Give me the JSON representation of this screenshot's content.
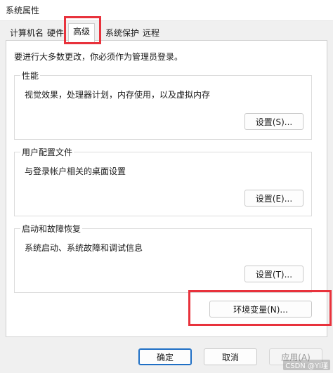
{
  "window": {
    "title": "系统属性"
  },
  "tabs": [
    {
      "label": "计算机名"
    },
    {
      "label": "硬件"
    },
    {
      "label": "高级",
      "active": true
    },
    {
      "label": "系统保护"
    },
    {
      "label": "远程"
    }
  ],
  "admin_note": "要进行大多数更改，你必须作为管理员登录。",
  "groups": {
    "performance": {
      "title": "性能",
      "description": "视觉效果，处理器计划，内存使用，以及虚拟内存",
      "button": "设置(S)..."
    },
    "user_profiles": {
      "title": "用户配置文件",
      "description": "与登录帐户相关的桌面设置",
      "button": "设置(E)..."
    },
    "startup_recovery": {
      "title": "启动和故障恢复",
      "description": "系统启动、系统故障和调试信息",
      "button": "设置(T)..."
    }
  },
  "env_button": "环境变量(N)...",
  "footer": {
    "ok": "确定",
    "cancel": "取消",
    "apply": "应用(A)"
  },
  "watermark": "CSDN @YI瑾",
  "colors": {
    "highlight": "#e8323c",
    "primary_border": "#1f6fc5"
  }
}
